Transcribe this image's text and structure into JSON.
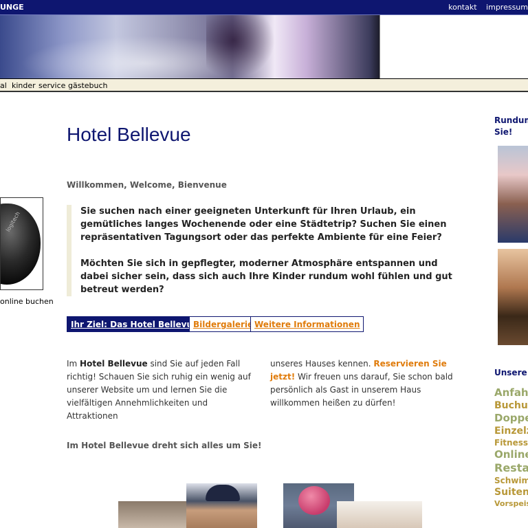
{
  "topbar": {
    "brand": "UNGE",
    "links": [
      "kontakt",
      "impressum"
    ]
  },
  "nav": {
    "items": [
      "al",
      "kinder",
      "service",
      "gästebuch"
    ]
  },
  "left": {
    "product_logo": "logitech",
    "online_text": "online buchen"
  },
  "main": {
    "title": "Hotel Bellevue",
    "welcome": "Willkommen, Welcome, Bienvenue",
    "intro_p1": "Sie suchen nach einer geeigneten Unterkunft für Ihren Urlaub, ein gemütliches langes Wochenende oder eine Städtetrip? Suchen Sie einen repräsentativen Tagungsort oder das perfekte Ambiente für eine Feier?",
    "intro_p2": "Möchten Sie sich in gepflegter, moderner Atmosphäre entspannen und dabei sicher sein, dass sich auch Ihre Kinder rundum wohl fühlen und gut betreut werden?",
    "buttons": [
      {
        "label": "Ihr Ziel: Das Hotel Bellevue",
        "active": true
      },
      {
        "label": "Bildergalerie",
        "active": false
      },
      {
        "label": "Weitere Informationen",
        "active": false
      }
    ],
    "col1": {
      "lead": "Im ",
      "lead_bold": "Hotel Bellevue",
      "text": " sind Sie auf jeden Fall richtig! Schauen Sie sich ruhig ein wenig auf unserer Website um und lernen Sie die vielfältigen Annehmlichkeiten und Attraktionen"
    },
    "col2": {
      "text": "unseres Hauses kennen. ",
      "reserve": "Reservieren Sie jetzt!",
      "text2": " Wir freuen uns darauf, Sie schon bald persönlich als Gast in unserem Haus willkommen heißen zu dürfen!"
    },
    "tagline": "Im Hotel Bellevue dreht sich alles um Sie!"
  },
  "right": {
    "title": "Rundum\nSie!",
    "subtitle": "Unsere",
    "tags": [
      {
        "label": "Anfahrt",
        "size": 15,
        "color": "#9aa86a"
      },
      {
        "label": "Buchung",
        "size": 14,
        "color": "#b89838"
      },
      {
        "label": "Doppel",
        "size": 15,
        "color": "#9aa86a"
      },
      {
        "label": "Einzelzi",
        "size": 14,
        "color": "#b89838"
      },
      {
        "label": "Fitness",
        "size": 12,
        "color": "#b89838"
      },
      {
        "label": "Online",
        "size": 15,
        "color": "#9aa86a"
      },
      {
        "label": "Restau",
        "size": 16,
        "color": "#9aa86a"
      },
      {
        "label": "Schwim",
        "size": 12,
        "color": "#b89838"
      },
      {
        "label": "Suiten",
        "size": 14,
        "color": "#b89838"
      },
      {
        "label": "Vorspeis",
        "size": 11,
        "color": "#b89838"
      }
    ]
  },
  "colors": {
    "navy": "#0e1670",
    "orange": "#e07c0c",
    "nav_bg": "#f4efdc"
  }
}
